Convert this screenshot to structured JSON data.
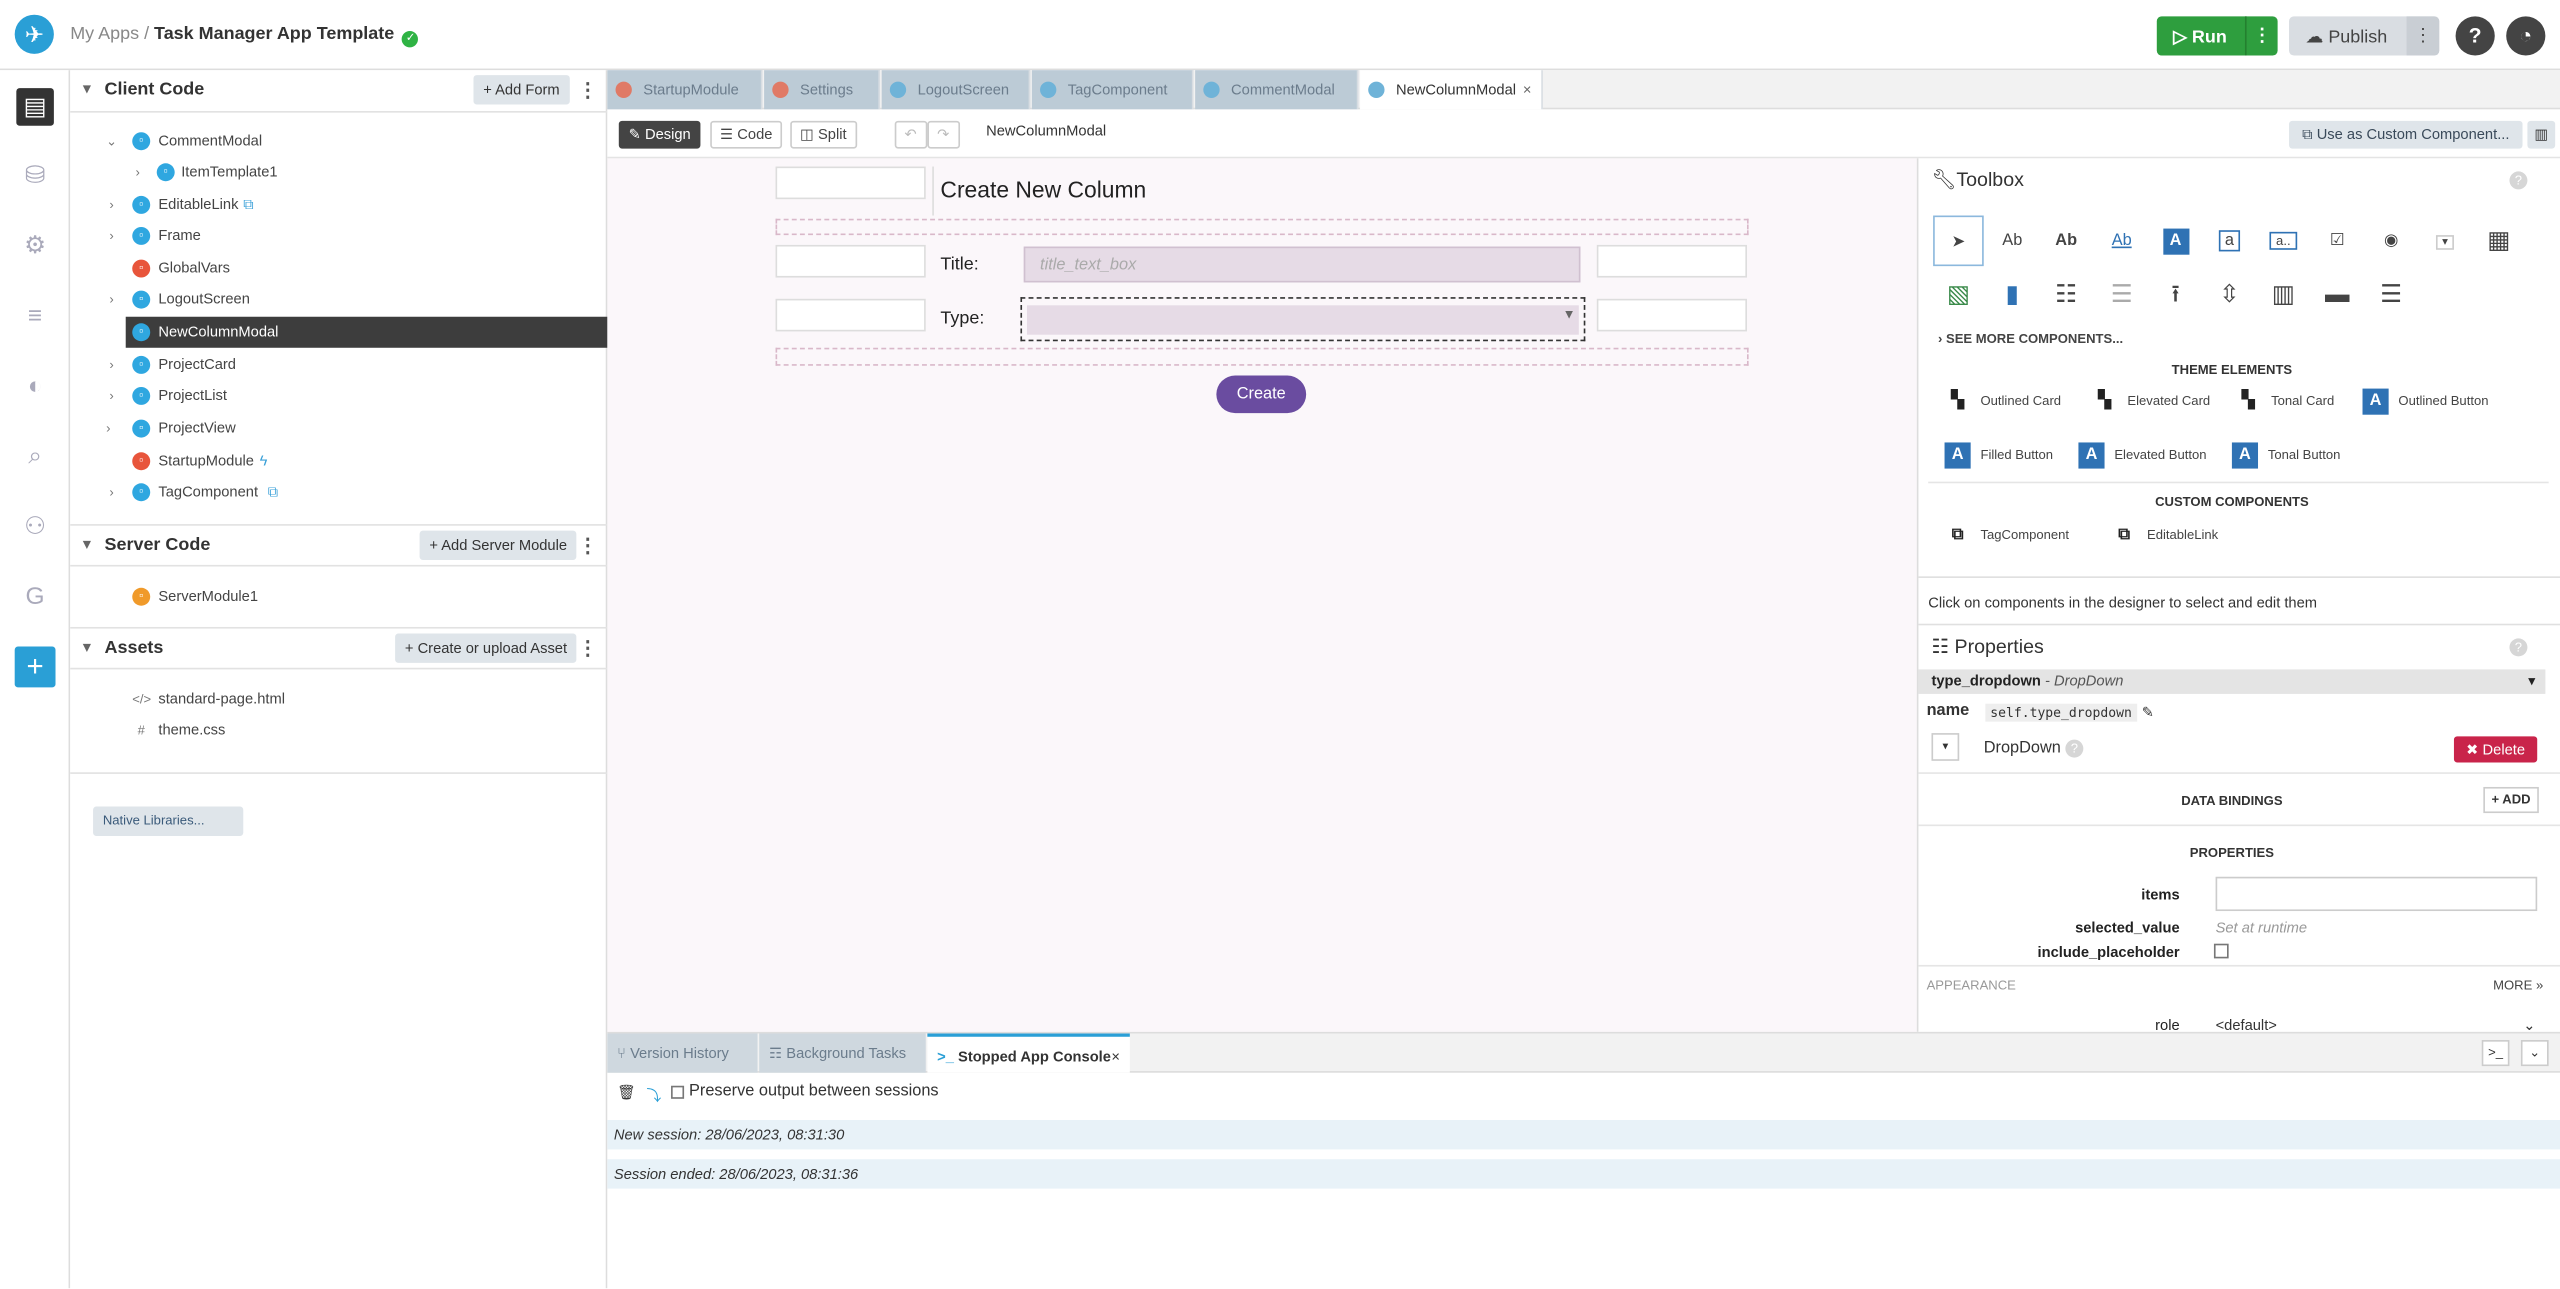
{
  "header": {
    "crumb_root": "My Apps",
    "crumb_sep": " / ",
    "app_title": "Task Manager App Template",
    "run_label": "Run",
    "publish_label": "Publish"
  },
  "left": {
    "client_code_title": "Client Code",
    "add_form_label": "+ Add Form",
    "client_items": [
      {
        "label": "CommentModal"
      },
      {
        "label": "ItemTemplate1"
      },
      {
        "label": "EditableLink"
      },
      {
        "label": "Frame"
      },
      {
        "label": "GlobalVars"
      },
      {
        "label": "LogoutScreen"
      },
      {
        "label": "NewColumnModal"
      },
      {
        "label": "ProjectCard"
      },
      {
        "label": "ProjectList"
      },
      {
        "label": "ProjectView"
      },
      {
        "label": "StartupModule"
      },
      {
        "label": "TagComponent"
      }
    ],
    "server_code_title": "Server Code",
    "add_server_label": "+ Add Server Module",
    "server_items": [
      {
        "label": "ServerModule1"
      }
    ],
    "assets_title": "Assets",
    "add_asset_label": "+ Create or upload Asset",
    "asset_items": [
      {
        "label": "standard-page.html",
        "icon": "</>"
      },
      {
        "label": "theme.css",
        "icon": "#"
      }
    ],
    "native_label": "Native Libraries..."
  },
  "tabs": [
    {
      "label": "StartupModule"
    },
    {
      "label": "Settings"
    },
    {
      "label": "LogoutScreen"
    },
    {
      "label": "TagComponent"
    },
    {
      "label": "CommentModal"
    },
    {
      "label": "NewColumnModal"
    }
  ],
  "editor": {
    "design_label": "Design",
    "code_label": "Code",
    "split_label": "Split",
    "form_name": "NewColumnModal",
    "custom_label": "Use as Custom Component..."
  },
  "form": {
    "title": "Create New Column",
    "title_label": "Title:",
    "title_placeholder": "title_text_box",
    "type_label": "Type:",
    "create_label": "Create"
  },
  "toolbox": {
    "title": "Toolbox",
    "see_more": "SEE MORE COMPONENTS...",
    "theme_heading": "THEME ELEMENTS",
    "theme_items": [
      {
        "label": "Outlined Card"
      },
      {
        "label": "Elevated Card"
      },
      {
        "label": "Tonal Card"
      },
      {
        "label": "Outlined Button"
      },
      {
        "label": "Filled Button"
      },
      {
        "label": "Elevated Button"
      },
      {
        "label": "Tonal Button"
      }
    ],
    "custom_heading": "CUSTOM COMPONENTS",
    "custom_items": [
      {
        "label": "TagComponent"
      },
      {
        "label": "EditableLink"
      }
    ],
    "hint": "Click on components in the designer to select and edit them"
  },
  "properties": {
    "title": "Properties",
    "component_name": "type_dropdown",
    "component_type": "- DropDown",
    "name_label": "name",
    "name_value": "self.type_dropdown",
    "kind_label": "DropDown",
    "delete_label": "Delete",
    "bindings_label": "DATA BINDINGS",
    "add_label": "+ ADD",
    "props_label": "PROPERTIES",
    "items_label": "items",
    "selected_label": "selected_value",
    "selected_placeholder": "Set at runtime",
    "placeholder_label": "include_placeholder",
    "appearance_label": "APPEARANCE",
    "more_label": "MORE",
    "role_label": "role",
    "role_value": "<default>"
  },
  "console": {
    "tabs": [
      {
        "label": "Version History"
      },
      {
        "label": "Background Tasks"
      },
      {
        "label": "Stopped App Console"
      }
    ],
    "preserve_label": "Preserve output between sessions",
    "lines": [
      {
        "text": "New session: 28/06/2023, 08:31:30"
      },
      {
        "text": "Session ended: 28/06/2023, 08:31:36"
      }
    ]
  },
  "colors": {
    "accent": "#2a9fd6",
    "run": "#2e9e3e",
    "create": "#6a4ca0",
    "delete": "#c9244a"
  }
}
